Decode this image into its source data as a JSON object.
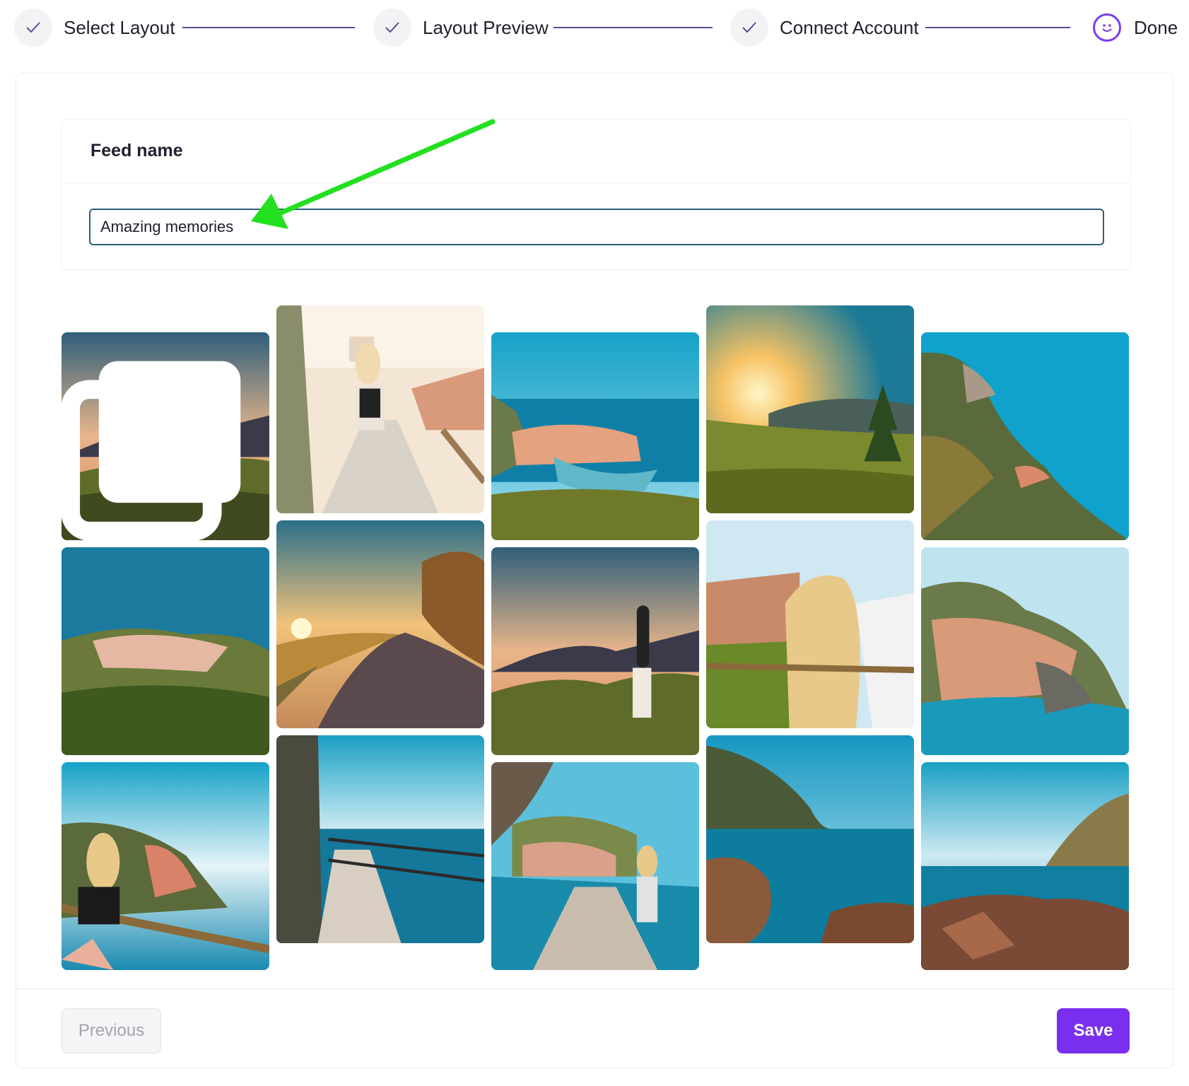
{
  "stepper": {
    "steps": [
      {
        "label": "Select Layout",
        "state": "completed"
      },
      {
        "label": "Layout Preview",
        "state": "completed"
      },
      {
        "label": "Connect Account",
        "state": "completed"
      },
      {
        "label": "Done",
        "state": "current"
      }
    ],
    "check_icon": "check-icon",
    "done_icon": "smiley-icon",
    "accent_color": "#7a3cf0"
  },
  "feed": {
    "title": "Feed name",
    "input_value": "Amazing memories"
  },
  "annotation": {
    "arrow_color": "#22e01f"
  },
  "photos": [
    {
      "name": "woman-on-cliff-sunset",
      "multi": true
    },
    {
      "name": "woman-walking-path-village"
    },
    {
      "name": "vernazza-harbor"
    },
    {
      "name": "sunset-over-hills"
    },
    {
      "name": "coastline-cliffs"
    },
    {
      "name": "hillside-village-sea"
    },
    {
      "name": "coastal-road-sunset"
    },
    {
      "name": "woman-on-cliff-sunset-2"
    },
    {
      "name": "woman-looking-at-village"
    },
    {
      "name": "manarola-village"
    },
    {
      "name": "follow-me-manarola"
    },
    {
      "name": "cliff-walkway-railing"
    },
    {
      "name": "woman-on-walkway"
    },
    {
      "name": "rocky-bay"
    },
    {
      "name": "rocky-shore-cliffs"
    }
  ],
  "footer": {
    "previous_label": "Previous",
    "save_label": "Save",
    "save_color": "#7a2ff0"
  }
}
